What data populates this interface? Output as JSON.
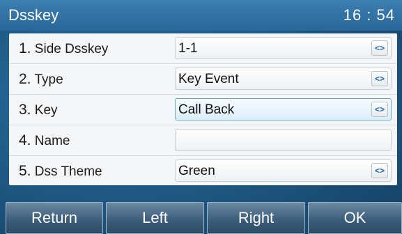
{
  "header": {
    "title": "Dsskey",
    "clock": "16 : 54"
  },
  "rows": [
    {
      "number": "1.",
      "label": "Side Dsskey",
      "value": "1-1",
      "control": "<>"
    },
    {
      "number": "2.",
      "label": "Type",
      "value": "Key Event",
      "control": "<>"
    },
    {
      "number": "3.",
      "label": "Key",
      "value": "Call Back",
      "control": "<>"
    },
    {
      "number": "4.",
      "label": "Name",
      "value": "",
      "control": ""
    },
    {
      "number": "5.",
      "label": "Dss Theme",
      "value": "Green",
      "control": "<>"
    }
  ],
  "softkeys": [
    "Return",
    "Left",
    "Right",
    "OK"
  ],
  "colors": {
    "background": "#1f5b86",
    "header": "#2a6799",
    "panel": "#f4f6f8",
    "focus_border": "#6aa9d6",
    "spin_glyph": "#1e6aa8"
  }
}
